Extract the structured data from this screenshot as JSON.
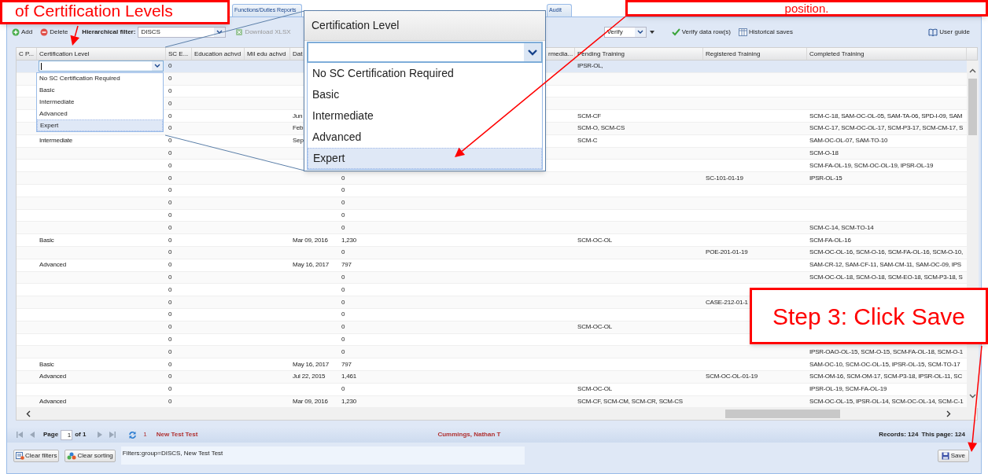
{
  "annotations": [
    {
      "text": "of Certification Levels"
    },
    {
      "text": "position."
    },
    {
      "text": "Step 3: Click Save"
    }
  ],
  "tabs": [
    {
      "label": "Functions/Duties Reports"
    },
    {
      "label": "Audit"
    }
  ],
  "toolbar": {
    "buttons": [
      {
        "label": "Add"
      },
      {
        "label": "Delete"
      }
    ],
    "filter_label": "Hierarchical filter:",
    "filter_value": "DISCS",
    "download": {
      "label": "Download XLSX",
      "disabled": true
    },
    "verify_value": "Verify",
    "actions": [
      {
        "label": "Verify data row(s)"
      },
      {
        "label": "Historical saves"
      }
    ],
    "user_guide": "User guide"
  },
  "table": {
    "columns": [
      "C P...",
      "Certification Level",
      "SC E...",
      "Education achvd",
      "Mil edu achvd",
      "Dat",
      "rmedia...",
      "Pending Training",
      "Registered Training",
      "Completed Training"
    ],
    "editor": {
      "options": [
        {
          "label": "No SC Certification Required",
          "selected": false
        },
        {
          "label": "Basic",
          "selected": false
        },
        {
          "label": "Intermediate",
          "selected": false
        },
        {
          "label": "Advanced",
          "selected": false
        },
        {
          "label": "Expert",
          "selected": true
        }
      ]
    },
    "rows": [
      {
        "selected": true,
        "sc_e": "0",
        "pending_training": "IPSR-OL,"
      },
      {
        "selected": false,
        "sc_e": "0"
      },
      {
        "selected": false,
        "sc_e": "0"
      },
      {
        "selected": false,
        "sc_e": "0"
      },
      {
        "selected": false,
        "sc_e": "0",
        "column_6": "Jun",
        "pending_training": "SCM-CF",
        "completed_training": "SCM-C-18, SAM-OC-OL-05, SAM-TA-06, SPD-I-09, SAM"
      },
      {
        "selected": false,
        "sc_e": "0",
        "column_6": "Feb",
        "pending_training": "SCM-O, SCM-CS",
        "completed_training": "SCM-C-17, SCM-OC-OL-17, SCM-P3-17, SCM-CM-17, S"
      },
      {
        "selected": false,
        "certification_level": "Intermediate",
        "sc_e": "0",
        "column_6": "Sep",
        "pending_training": "SCM-C",
        "completed_training": "SAM-OC-OL-07, SAM-TO-10"
      },
      {
        "selected": false,
        "sc_e": "0",
        "completed_training": "SCM-O-18"
      },
      {
        "selected": false,
        "sc_e": "0",
        "completed_training": "SCM-FA-OL-19, SCM-OC-OL-19, IPSR-OL-19"
      },
      {
        "selected": false,
        "sc_e": "0",
        "column_7": "0",
        "registered_training": "SC-101-01-19",
        "completed_training": "IPSR-OL-15"
      },
      {
        "selected": false,
        "sc_e": "0",
        "column_7": "0"
      },
      {
        "selected": false,
        "sc_e": "0",
        "column_7": "0"
      },
      {
        "selected": false,
        "sc_e": "0",
        "column_7": "0"
      },
      {
        "selected": false,
        "sc_e": "0",
        "column_7": "0",
        "completed_training": "SCM-C-14, SCM-TO-14"
      },
      {
        "selected": false,
        "certification_level": "Basic",
        "sc_e": "0",
        "column_6": "Mar 09, 2016",
        "column_7": "1,230",
        "pending_training": "SCM-OC-OL",
        "completed_training": "SCM-FA-OL-16"
      },
      {
        "selected": false,
        "sc_e": "0",
        "column_7": "0",
        "registered_training": "POE-201-01-19",
        "completed_training": "SCM-OC-OL-16, SCM-O-16, SCM-FA-OL-16, SCM-O-10,"
      },
      {
        "selected": false,
        "certification_level": "Advanced",
        "sc_e": "0",
        "column_6": "May 16, 2017",
        "column_7": "797",
        "completed_training": "SAM-CR-12, SAM-CF-11, SAM-CM-11, SAM-OC-09, IPS"
      },
      {
        "selected": false,
        "sc_e": "0",
        "column_7": "0",
        "completed_training": "SCM-OC-OL-18, SCM-O-18, SCM-EO-18, SCM-P3-18, S"
      },
      {
        "selected": false,
        "sc_e": "0",
        "column_7": "0"
      },
      {
        "selected": false,
        "sc_e": "0",
        "column_7": "0",
        "registered_training": "CASE-212-01-1"
      },
      {
        "selected": false,
        "sc_e": "0",
        "column_7": "0"
      },
      {
        "selected": false,
        "sc_e": "0",
        "column_7": "0",
        "pending_training": "SCM-OC-OL"
      },
      {
        "selected": false,
        "sc_e": "0",
        "column_7": "0"
      },
      {
        "selected": false,
        "sc_e": "0",
        "column_7": "0",
        "completed_training": "IPSR-OAO-OL-15, SCM-O-15, SCM-FA-OL-18, SCM-O-1"
      },
      {
        "selected": false,
        "certification_level": "Basic",
        "sc_e": "0",
        "column_6": "May 16, 2017",
        "column_7": "797",
        "completed_training": "SAM-OC-10, SCM-OC-OL-15, IPSR-OL-15, SCM-TO-17"
      },
      {
        "selected": false,
        "certification_level": "Advanced",
        "sc_e": "0",
        "column_6": "Jul 22, 2015",
        "column_7": "1,461",
        "registered_training": "SCM-OC-OL-01-19",
        "completed_training": "SCM-OM-16, SCM-OM-17, SCM-P3-18, IPSR-OL-11, SC"
      },
      {
        "selected": false,
        "sc_e": "0",
        "column_7": "0",
        "pending_training": "SCM-OC-OL",
        "completed_training": "IPSR-OL-19, SCM-FA-OL-19"
      },
      {
        "selected": false,
        "certification_level": "Advanced",
        "sc_e": "0",
        "column_6": "Mar 09, 2016",
        "column_7": "1,230",
        "pending_training": "SCM-CF, SCM-CM, SCM-CR, SCM-CS",
        "completed_training": "SCM-OC-OL-15, IPSR-OL-14, SCM-OC-OL-14, SCM-C-1"
      }
    ]
  },
  "zoom_callout": {
    "title": "Certification Level",
    "options": [
      {
        "label": "No SC Certification Required",
        "selected": false
      },
      {
        "label": "Basic",
        "selected": false
      },
      {
        "label": "Intermediate",
        "selected": false
      },
      {
        "label": "Advanced",
        "selected": false
      },
      {
        "label": "Expert",
        "selected": true
      }
    ]
  },
  "pager": {
    "page_label": "Page",
    "page_value": "1",
    "of_label": "of 1",
    "count": "1",
    "group": "New Test Test",
    "user": "Cummings, Nathan T",
    "records": "Records: 124",
    "this_page": "This page: 124"
  },
  "bottom_bar": {
    "buttons": [
      {
        "label": "Clear filters"
      },
      {
        "label": "Clear sorting"
      }
    ],
    "filters_text": "Filters:group=DISCS, New Test Test",
    "save": "Save"
  }
}
